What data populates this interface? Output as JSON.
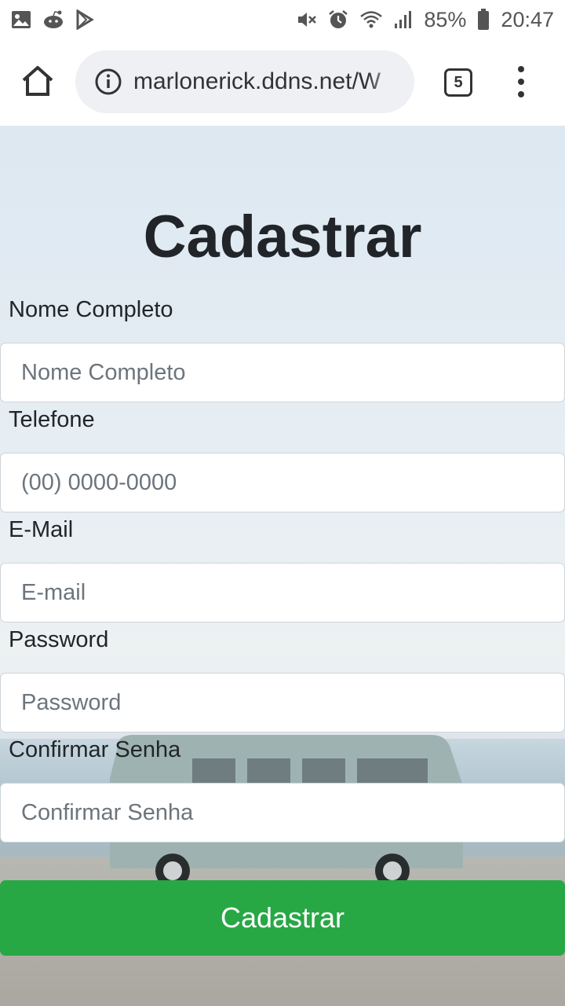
{
  "status_bar": {
    "battery": "85%",
    "time": "20:47",
    "left_icons": [
      "image-icon",
      "reddit-icon",
      "play-store-icon"
    ],
    "right_icons": [
      "mute-icon",
      "alarm-icon",
      "wifi-icon",
      "signal-icon",
      "battery-icon"
    ]
  },
  "browser": {
    "url": "marlonerick.ddns.net/W",
    "tab_count": "5",
    "icons": [
      "home-icon",
      "info-icon",
      "tabs-icon",
      "more-vert-icon"
    ]
  },
  "form": {
    "title": "Cadastrar",
    "fields": [
      {
        "label": "Nome Completo",
        "placeholder": "Nome Completo",
        "value": ""
      },
      {
        "label": "Telefone",
        "placeholder": "(00) 0000-0000",
        "value": ""
      },
      {
        "label": "E-Mail",
        "placeholder": "E-mail",
        "value": ""
      },
      {
        "label": "Password",
        "placeholder": "Password",
        "value": ""
      },
      {
        "label": "Confirmar Senha",
        "placeholder": "Confirmar Senha",
        "value": ""
      }
    ],
    "submit_label": "Cadastrar"
  },
  "colors": {
    "submit_button": "#28a745",
    "title_text": "#212529"
  }
}
